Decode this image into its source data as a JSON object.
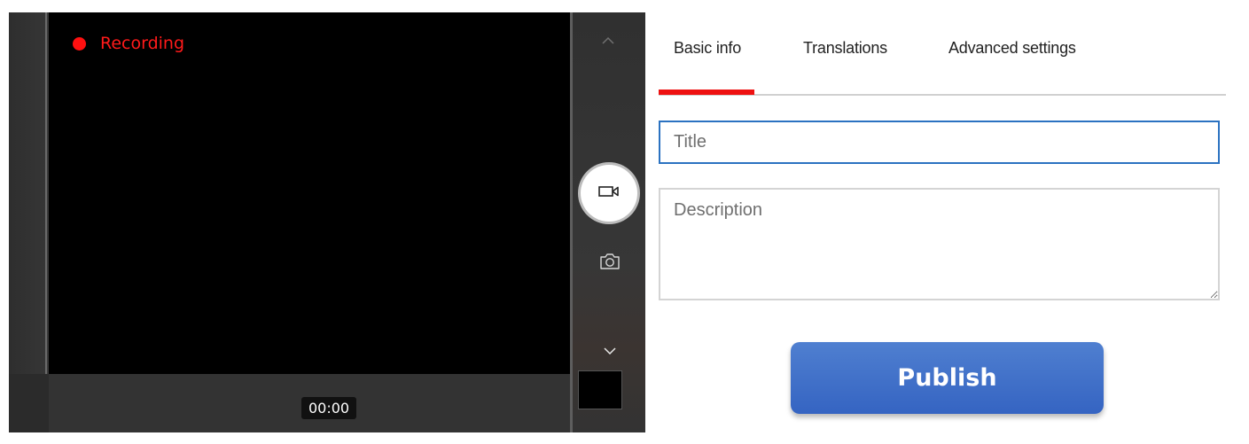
{
  "camera": {
    "recording_label": "Recording",
    "recording_color": "#ff1a1a",
    "timer": "00:00",
    "icons": {
      "scroll_up": "chevron-up-icon",
      "video_mode": "video-camera-icon",
      "photo_mode": "camera-icon",
      "scroll_down": "chevron-down-icon"
    }
  },
  "form": {
    "tabs": [
      {
        "label": "Basic info",
        "active": true
      },
      {
        "label": "Translations",
        "active": false
      },
      {
        "label": "Advanced settings",
        "active": false
      }
    ],
    "title_placeholder": "Title",
    "title_value": "",
    "description_placeholder": "Description",
    "description_value": "",
    "publish_label": "Publish",
    "accent_color": "#ee1111",
    "focus_color": "#2b72c1",
    "button_color": "#3f6fc9"
  }
}
